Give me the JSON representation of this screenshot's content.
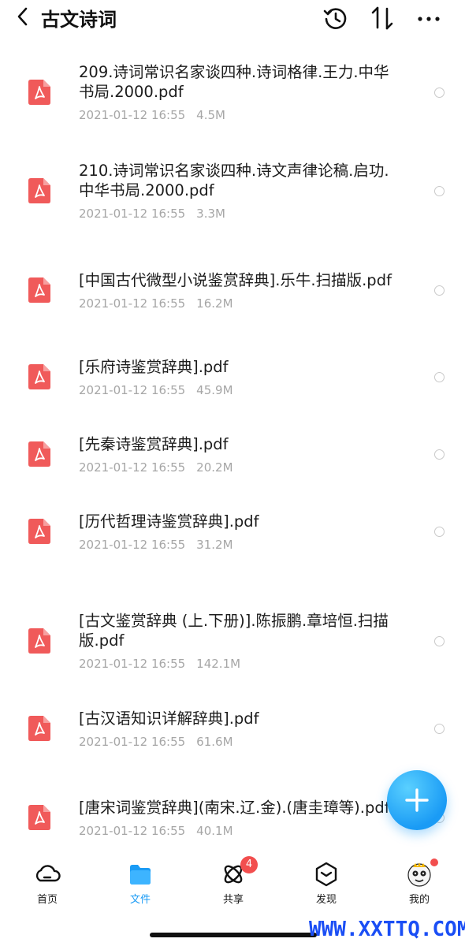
{
  "header": {
    "title": "古文诗词"
  },
  "files": [
    {
      "name": "209.诗词常识名家谈四种.诗词格律.王力.中华书局.2000.pdf",
      "date": "2021-01-12 16:55",
      "size": "4.5M"
    },
    {
      "name": "210.诗词常识名家谈四种.诗文声律论稿.启功.中华书局.2000.pdf",
      "date": "2021-01-12 16:55",
      "size": "3.3M"
    },
    {
      "name": "[中国古代微型小说鉴赏辞典].乐牛.扫描版.pdf",
      "date": "2021-01-12 16:55",
      "size": "16.2M"
    },
    {
      "name": "[乐府诗鉴赏辞典].pdf",
      "date": "2021-01-12 16:55",
      "size": "45.9M"
    },
    {
      "name": "[先秦诗鉴赏辞典].pdf",
      "date": "2021-01-12 16:55",
      "size": "20.2M"
    },
    {
      "name": "[历代哲理诗鉴赏辞典].pdf",
      "date": "2021-01-12 16:55",
      "size": "31.2M"
    },
    {
      "name": "[古文鉴赏辞典 (上.下册)].陈振鹏.章培恒.扫描版.pdf",
      "date": "2021-01-12 16:55",
      "size": "142.1M"
    },
    {
      "name": "[古汉语知识详解辞典].pdf",
      "date": "2021-01-12 16:55",
      "size": "61.6M"
    },
    {
      "name": "[唐宋词鉴赏辞典](南宋.辽.金).(唐圭璋等).pdf",
      "date": "2021-01-12 16:55",
      "size": "40.1M"
    }
  ],
  "tabs": {
    "home": "首页",
    "files": "文件",
    "share": "共享",
    "share_badge": "4",
    "discover": "发现",
    "mine": "我的"
  },
  "watermark": "WWW.XXTTQ.COM",
  "colors": {
    "accent": "#1a9bf5",
    "pdf": "#f05a5a",
    "badge": "#f24e4e"
  }
}
